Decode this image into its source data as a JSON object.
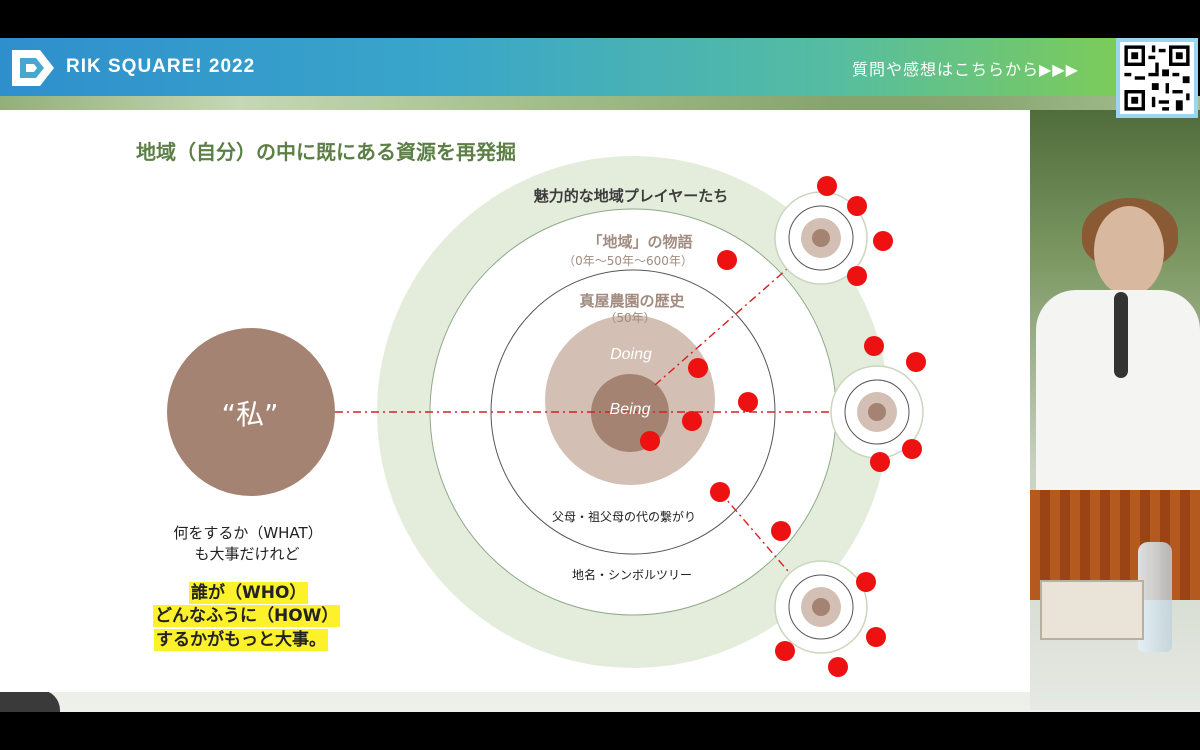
{
  "header": {
    "app_title": "RIK SQUARE! 2022",
    "feedback_link": "質問や感想はこちらから▶▶▶"
  },
  "slide": {
    "title": "地域（自分）の中に既にある資源を再発掘",
    "players_label": "魅力的な地域プレイヤーたち",
    "story_title": "「地域」の物語",
    "story_sub": "（0年〜50年〜600年）",
    "history_title": "真屋農園の歴史",
    "history_sub": "（50年）",
    "doing_label": "Doing",
    "being_label": "Being",
    "family_label": "父母・祖父母の代の繋がり",
    "place_label": "地名・シンボルツリー",
    "watashi_label": "“私”",
    "what_line1": "何をするか（WHAT）",
    "what_line2": "も大事だけれど",
    "who_line1": "誰が（WHO）",
    "who_line2": "どんなふうに（HOW）",
    "who_line3": "するかがもっと大事。"
  },
  "colors": {
    "header_gradient_start": "#2f8fcd",
    "header_gradient_end": "#7ccb5a",
    "title_green": "#5b7f45",
    "outer_ring": "#e4eddc",
    "core_brown": "#a48373",
    "inner_brown": "#d3bfb3",
    "accent_red": "#ee1111",
    "highlight_yellow": "#fdf12b"
  }
}
